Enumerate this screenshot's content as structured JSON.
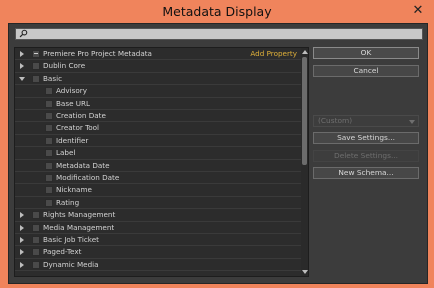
{
  "window": {
    "title": "Metadata Display",
    "close_symbol": "✕"
  },
  "search": {
    "value": ""
  },
  "tree": {
    "add_property": "Add Property",
    "items": [
      {
        "label": "Premiere Pro Project Metadata",
        "level": 0,
        "expander": "collapsed",
        "check": "partial"
      },
      {
        "label": "Dublin Core",
        "level": 0,
        "expander": "collapsed",
        "check": "none"
      },
      {
        "label": "Basic",
        "level": 0,
        "expander": "expanded",
        "check": "none"
      },
      {
        "label": "Advisory",
        "level": 1,
        "check": "none"
      },
      {
        "label": "Base URL",
        "level": 1,
        "check": "none"
      },
      {
        "label": "Creation Date",
        "level": 1,
        "check": "none"
      },
      {
        "label": "Creator Tool",
        "level": 1,
        "check": "none"
      },
      {
        "label": "Identifier",
        "level": 1,
        "check": "none"
      },
      {
        "label": "Label",
        "level": 1,
        "check": "none"
      },
      {
        "label": "Metadata Date",
        "level": 1,
        "check": "none"
      },
      {
        "label": "Modification Date",
        "level": 1,
        "check": "none"
      },
      {
        "label": "Nickname",
        "level": 1,
        "check": "none"
      },
      {
        "label": "Rating",
        "level": 1,
        "check": "none"
      },
      {
        "label": "Rights Management",
        "level": 0,
        "expander": "collapsed",
        "check": "none"
      },
      {
        "label": "Media Management",
        "level": 0,
        "expander": "collapsed",
        "check": "none"
      },
      {
        "label": "Basic Job Ticket",
        "level": 0,
        "expander": "collapsed",
        "check": "none"
      },
      {
        "label": "Paged-Text",
        "level": 0,
        "expander": "collapsed",
        "check": "none"
      },
      {
        "label": "Dynamic Media",
        "level": 0,
        "expander": "collapsed",
        "check": "none"
      }
    ]
  },
  "buttons": {
    "ok": "OK",
    "cancel": "Cancel",
    "save_settings": "Save Settings...",
    "delete_settings": "Delete Settings...",
    "new_schema": "New Schema..."
  },
  "settings_select": {
    "value": "(Custom)"
  },
  "colors": {
    "accent_link": "#e0b13a",
    "window_frame": "#f0845c",
    "panel_bg": "#3c3c3c"
  }
}
